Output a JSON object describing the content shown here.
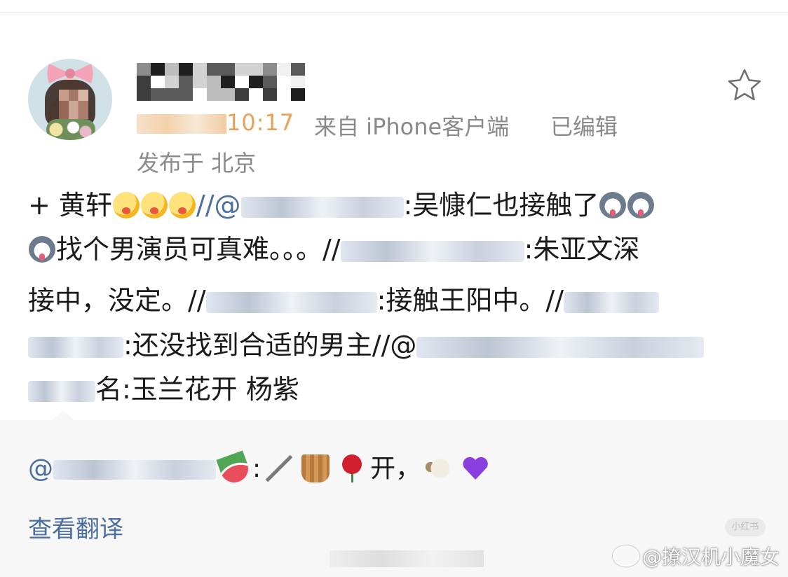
{
  "post": {
    "meta": {
      "time_suffix": "10:17",
      "source": "来自 iPhone客户端",
      "edited": "已编辑",
      "location": "发布于 北京"
    },
    "favorite_icon": "star-outline-icon",
    "lines": {
      "l1_prefix": "+ 黄轩",
      "l1_sep": "//@",
      "l1_tail": ":吴慷仁也接触了",
      "l2_text": "找个男演员可真难。。。//",
      "l2_tail": ":朱亚文深",
      "l3_text": "接中，没定。//",
      "l3_tail": ":接触王阳中。//",
      "l4_text": ":还没找到合适的男主//@",
      "l5_tail": "名:玉兰花开 杨紫"
    }
  },
  "comment": {
    "prefix": "@",
    "colon1": ":",
    "text_kai": "开，",
    "translate": "查看翻译"
  },
  "overlay": {
    "xhs_tag": "小红书",
    "watermark": "@撩汉机小魔女"
  },
  "colors": {
    "link": "#4a6fa0",
    "time": "#e7a15a",
    "meta": "#8a8a8a",
    "comment_bg": "#f7f7f7"
  }
}
